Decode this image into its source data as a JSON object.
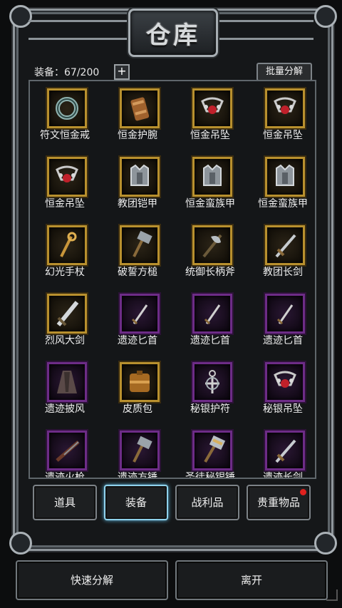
{
  "title": "仓库",
  "topbar": {
    "count_label": "装备：67/200",
    "plus": "+",
    "bulk_button": "批量分解"
  },
  "items": [
    {
      "name": "符文恒金戒",
      "rarity": "gold",
      "icon": "ring-icon"
    },
    {
      "name": "恒金护腕",
      "rarity": "gold",
      "icon": "bracer-icon"
    },
    {
      "name": "恒金吊坠",
      "rarity": "gold",
      "icon": "pendant-icon"
    },
    {
      "name": "恒金吊坠",
      "rarity": "gold",
      "icon": "pendant-icon"
    },
    {
      "name": "恒金吊坠",
      "rarity": "gold",
      "icon": "pendant-icon"
    },
    {
      "name": "教团铠甲",
      "rarity": "gold",
      "icon": "armor-icon"
    },
    {
      "name": "恒金蛮族甲",
      "rarity": "gold",
      "icon": "armor-icon"
    },
    {
      "name": "恒金蛮族甲",
      "rarity": "gold",
      "icon": "armor-icon"
    },
    {
      "name": "幻光手杖",
      "rarity": "gold",
      "icon": "staff-icon"
    },
    {
      "name": "破誓方槌",
      "rarity": "gold",
      "icon": "hammer-icon"
    },
    {
      "name": "统御长柄斧",
      "rarity": "gold",
      "icon": "axe-icon"
    },
    {
      "name": "教团长剑",
      "rarity": "gold",
      "icon": "sword-icon"
    },
    {
      "name": "烈风大剑",
      "rarity": "gold",
      "icon": "greatsword-icon"
    },
    {
      "name": "遗迹匕首",
      "rarity": "purple",
      "icon": "dagger-icon"
    },
    {
      "name": "遗迹匕首",
      "rarity": "purple",
      "icon": "dagger-icon"
    },
    {
      "name": "遗迹匕首",
      "rarity": "purple",
      "icon": "dagger-icon"
    },
    {
      "name": "遗迹披风",
      "rarity": "purple",
      "icon": "cloak-icon"
    },
    {
      "name": "皮质包",
      "rarity": "gold",
      "icon": "bag-icon"
    },
    {
      "name": "秘银护符",
      "rarity": "purple",
      "icon": "amulet-icon"
    },
    {
      "name": "秘银吊坠",
      "rarity": "purple",
      "icon": "pendant-icon"
    },
    {
      "name": "遗迹火枪",
      "rarity": "purple",
      "icon": "musket-icon"
    },
    {
      "name": "遗迹方锤",
      "rarity": "purple",
      "icon": "hammer-icon"
    },
    {
      "name": "圣徒秘银锤",
      "rarity": "purple",
      "icon": "mace-icon"
    },
    {
      "name": "遗迹长剑",
      "rarity": "purple",
      "icon": "sword-icon"
    }
  ],
  "tabs": [
    {
      "label": "道具",
      "active": false,
      "badge": false
    },
    {
      "label": "装备",
      "active": true,
      "badge": false
    },
    {
      "label": "战利品",
      "active": false,
      "badge": false
    },
    {
      "label": "贵重物品",
      "active": false,
      "badge": true
    }
  ],
  "buttons": {
    "quick_disassemble": "快速分解",
    "leave": "离开"
  },
  "colors": {
    "gold_border": "#b8902e",
    "purple_border": "#6d2c87",
    "active_tab": "#8fd2ec",
    "badge": "#e0211e"
  }
}
